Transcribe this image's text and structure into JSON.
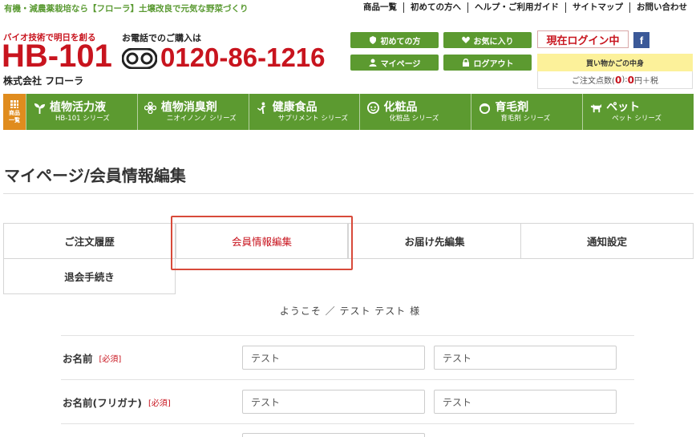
{
  "header": {
    "tagline": "有機・減農薬栽培なら【フローラ】土壌改良で元気な野菜づくり",
    "top_links": [
      "商品一覧",
      "初めての方へ",
      "ヘルプ・ご利用ガイド",
      "サイトマップ",
      "お問い合わせ"
    ],
    "logo_sub": "バイオ技術で明日を創る",
    "logo_main": "HB-101",
    "logo_company": "株式会社 フローラ",
    "phone_label": "お電話でのご購入は",
    "phone_number": "0120-86-1216",
    "buttons": {
      "first_time": "初めての方",
      "favorites": "お気に入り",
      "mypage": "マイページ",
      "logout": "ログアウト"
    },
    "login_status": "現在ログイン中",
    "facebook": "f",
    "cart_title": "買い物かごの中身",
    "cart": {
      "label": "ご注文点数(",
      "count": "0",
      "mid": "):",
      "amount": "0",
      "suffix": "円＋税"
    },
    "colors": {
      "brand_red": "#c8141e",
      "nav_green": "#5c9a30",
      "menu_orange": "#e08c1e"
    }
  },
  "nav": {
    "menu_label_1": "商品",
    "menu_label_2": "一覧",
    "items": [
      {
        "title": "植物活力液",
        "sub": "HB-101 シリーズ",
        "icon": "sprout-icon"
      },
      {
        "title": "植物消臭剤",
        "sub": "ニオイノンノ シリーズ",
        "icon": "flower-icon"
      },
      {
        "title": "健康食品",
        "sub": "サプリメント シリーズ",
        "icon": "person-icon"
      },
      {
        "title": "化粧品",
        "sub": "化粧品 シリーズ",
        "icon": "face-icon"
      },
      {
        "title": "育毛剤",
        "sub": "育毛剤 シリーズ",
        "icon": "hair-icon"
      },
      {
        "title": "ペット",
        "sub": "ペット シリーズ",
        "icon": "dog-icon"
      }
    ]
  },
  "page": {
    "title": "マイページ/会員情報編集",
    "tabs": [
      "ご注文履歴",
      "会員情報編集",
      "お届け先編集",
      "通知設定",
      "退会手続き"
    ],
    "active_tab": "会員情報編集",
    "welcome": "ようこそ ／ テスト テスト 様"
  },
  "form": {
    "required": "[必須]",
    "fields": [
      {
        "label": "お名前",
        "values": [
          "テスト",
          "テスト"
        ]
      },
      {
        "label": "お名前(フリガナ)",
        "values": [
          "テスト",
          "テスト"
        ]
      }
    ]
  }
}
